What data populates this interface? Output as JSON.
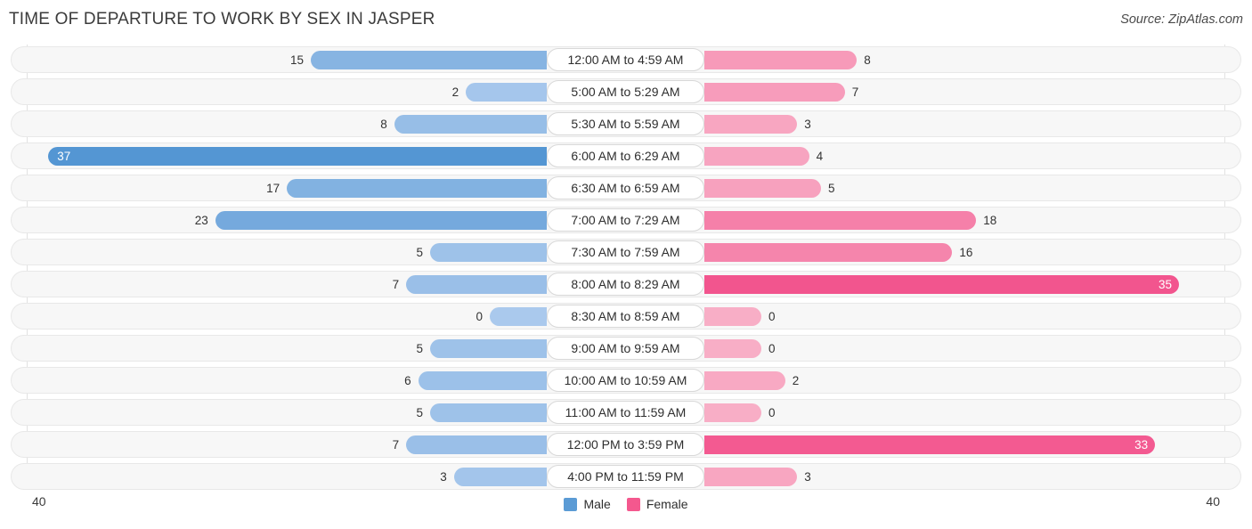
{
  "header": {
    "title": "TIME OF DEPARTURE TO WORK BY SEX IN JASPER",
    "source": "Source: ZipAtlas.com"
  },
  "legend": {
    "male_label": "Male",
    "female_label": "Female",
    "male_color": "#5B9BD5",
    "female_color": "#F4588E"
  },
  "axis": {
    "left_label": "40",
    "right_label": "40"
  },
  "chart_data": {
    "type": "bar",
    "title": "TIME OF DEPARTURE TO WORK BY SEX IN JASPER",
    "subtitle": "Source: ZipAtlas.com",
    "orientation": "horizontal-diverging",
    "xlabel": "",
    "ylabel": "",
    "xlim": [
      40,
      40
    ],
    "axis_left_max": 40,
    "axis_right_max": 40,
    "grid": true,
    "legend_position": "bottom-center",
    "categories": [
      "12:00 AM to 4:59 AM",
      "5:00 AM to 5:29 AM",
      "5:30 AM to 5:59 AM",
      "6:00 AM to 6:29 AM",
      "6:30 AM to 6:59 AM",
      "7:00 AM to 7:29 AM",
      "7:30 AM to 7:59 AM",
      "8:00 AM to 8:29 AM",
      "8:30 AM to 8:59 AM",
      "9:00 AM to 9:59 AM",
      "10:00 AM to 10:59 AM",
      "11:00 AM to 11:59 AM",
      "12:00 PM to 3:59 PM",
      "4:00 PM to 11:59 PM"
    ],
    "series": [
      {
        "name": "Male",
        "color": "#5B9BD5",
        "direction": "left",
        "values": [
          15,
          2,
          8,
          37,
          17,
          23,
          5,
          7,
          0,
          5,
          6,
          5,
          7,
          3
        ]
      },
      {
        "name": "Female",
        "color": "#F4588E",
        "direction": "right",
        "values": [
          8,
          7,
          3,
          4,
          5,
          18,
          16,
          35,
          0,
          0,
          2,
          0,
          33,
          3
        ]
      }
    ]
  }
}
